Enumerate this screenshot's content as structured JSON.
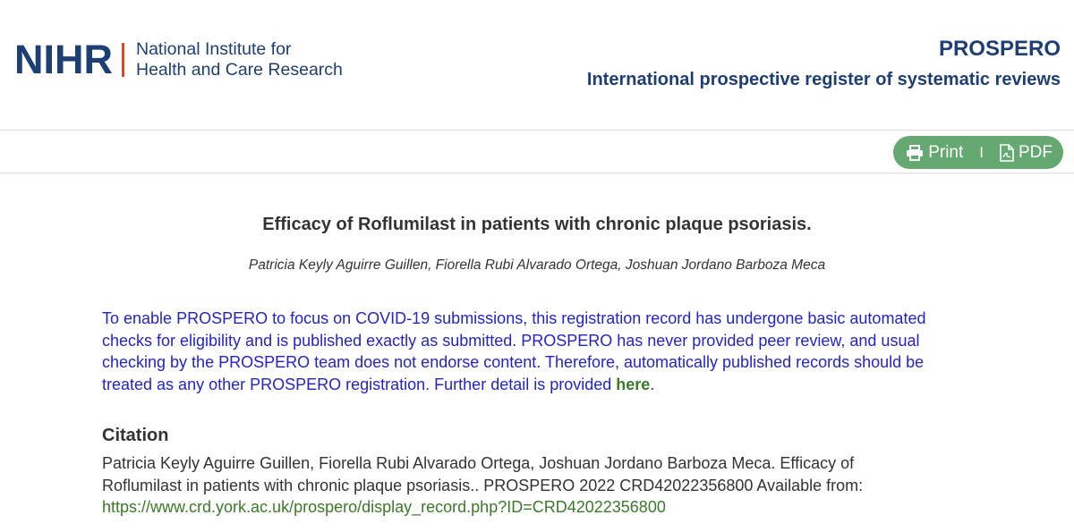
{
  "header": {
    "logo_mark": "NIHR",
    "logo_line1": "National Institute for",
    "logo_line2": "Health and Care Research",
    "brand_title": "PROSPERO",
    "brand_subtitle": "International prospective register of systematic reviews"
  },
  "toolbar": {
    "print_label": "Print",
    "separator": "I",
    "pdf_label": "PDF",
    "icons": [
      "printer-icon",
      "pdf-file-icon"
    ],
    "accent_color": "#66a872"
  },
  "record": {
    "title": "Efficacy of Roflumilast in patients with chronic plaque psoriasis.",
    "authors": "Patricia Keyly Aguirre Guillen, Fiorella Rubi Alvarado Ortega, Joshuan Jordano Barboza Meca"
  },
  "notice": {
    "text": "To enable PROSPERO to focus on COVID-19 submissions, this registration record has undergone basic automated checks for eligibility and is published exactly as submitted. PROSPERO has never provided peer review, and usual checking by the PROSPERO team does not endorse content. Therefore, automatically published records should be treated as any other PROSPERO registration. Further detail is provided ",
    "link_label": "here",
    "end": "."
  },
  "citation": {
    "heading": "Citation",
    "text": "Patricia Keyly Aguirre Guillen, Fiorella Rubi Alvarado Ortega, Joshuan Jordano Barboza Meca. Efficacy of Roflumilast in patients with chronic plaque psoriasis.. PROSPERO 2022 CRD42022356800 Available from:",
    "url": "https://www.crd.york.ac.uk/prospero/display_record.php?ID=CRD42022356800"
  }
}
